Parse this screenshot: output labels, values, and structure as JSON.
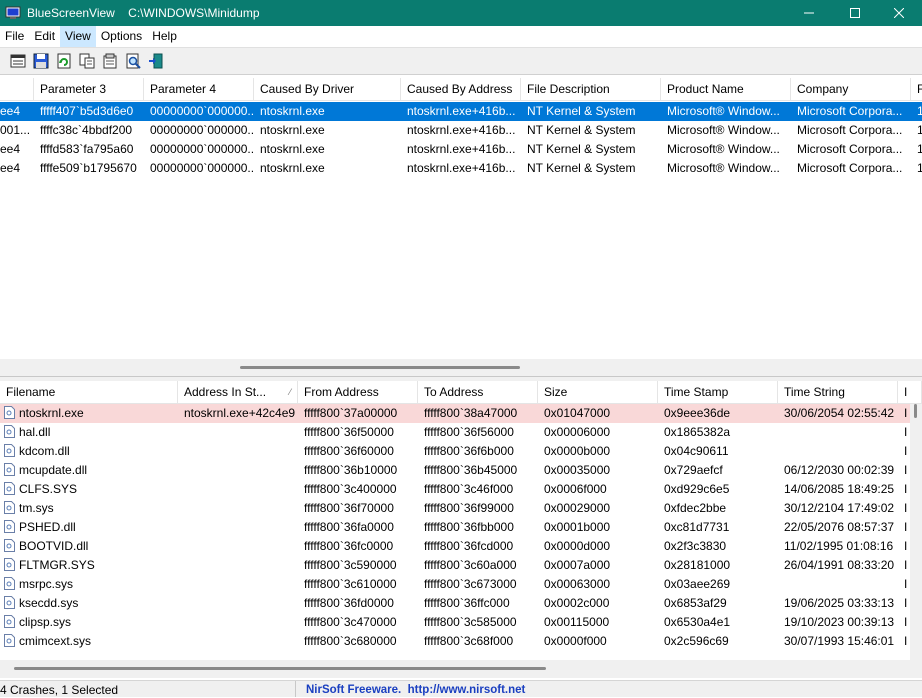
{
  "window": {
    "title": "BlueScreenView    C:\\WINDOWS\\Minidump",
    "minimize": "—",
    "maximize": "☐",
    "close": "✕"
  },
  "menu": [
    "File",
    "Edit",
    "View",
    "Options",
    "Help"
  ],
  "toolbar": {
    "icons": [
      "html-report-icon",
      "save-icon",
      "refresh-icon",
      "copy-icon",
      "properties-icon",
      "find-icon",
      "exit-icon"
    ]
  },
  "crash_list": {
    "columns": [
      "",
      "Parameter 3",
      "Parameter 4",
      "Caused By Driver",
      "Caused By Address",
      "File Description",
      "Product Name",
      "Company",
      "F"
    ],
    "rows": [
      [
        "ee4",
        "fffff407`b5d3d6e0",
        "00000000`000000...",
        "ntoskrnl.exe",
        "ntoskrnl.exe+416b...",
        "NT Kernel & System",
        "Microsoft® Window...",
        "Microsoft Corpora...",
        "1"
      ],
      [
        "001...",
        "ffffc38c`4bbdf200",
        "00000000`000000...",
        "ntoskrnl.exe",
        "ntoskrnl.exe+416b...",
        "NT Kernel & System",
        "Microsoft® Window...",
        "Microsoft Corpora...",
        "1"
      ],
      [
        "ee4",
        "ffffd583`fa795a60",
        "00000000`000000...",
        "ntoskrnl.exe",
        "ntoskrnl.exe+416b...",
        "NT Kernel & System",
        "Microsoft® Window...",
        "Microsoft Corpora...",
        "1"
      ],
      [
        "ee4",
        "ffffe509`b1795670",
        "00000000`000000...",
        "ntoskrnl.exe",
        "ntoskrnl.exe+416b...",
        "NT Kernel & System",
        "Microsoft® Window...",
        "Microsoft Corpora...",
        "1"
      ]
    ]
  },
  "driver_list": {
    "columns": [
      "Filename",
      "Address In St...",
      "From Address",
      "To Address",
      "Size",
      "Time Stamp",
      "Time String",
      "I"
    ],
    "rows": [
      [
        "ntoskrnl.exe",
        "ntoskrnl.exe+42c4e9",
        "fffff800`37a00000",
        "fffff800`38a47000",
        "0x01047000",
        "0x9eee36de",
        "30/06/2054 02:55:42",
        "I"
      ],
      [
        "hal.dll",
        "",
        "fffff800`36f50000",
        "fffff800`36f56000",
        "0x00006000",
        "0x1865382a",
        "",
        "I"
      ],
      [
        "kdcom.dll",
        "",
        "fffff800`36f60000",
        "fffff800`36f6b000",
        "0x0000b000",
        "0x04c90611",
        "",
        "I"
      ],
      [
        "mcupdate.dll",
        "",
        "fffff800`36b10000",
        "fffff800`36b45000",
        "0x00035000",
        "0x729aefcf",
        "06/12/2030 00:02:39",
        "I"
      ],
      [
        "CLFS.SYS",
        "",
        "fffff800`3c400000",
        "fffff800`3c46f000",
        "0x0006f000",
        "0xd929c6e5",
        "14/06/2085 18:49:25",
        "I"
      ],
      [
        "tm.sys",
        "",
        "fffff800`36f70000",
        "fffff800`36f99000",
        "0x00029000",
        "0xfdec2bbe",
        "30/12/2104 17:49:02",
        "I"
      ],
      [
        "PSHED.dll",
        "",
        "fffff800`36fa0000",
        "fffff800`36fbb000",
        "0x0001b000",
        "0xc81d7731",
        "22/05/2076 08:57:37",
        "I"
      ],
      [
        "BOOTVID.dll",
        "",
        "fffff800`36fc0000",
        "fffff800`36fcd000",
        "0x0000d000",
        "0x2f3c3830",
        "11/02/1995 01:08:16",
        "I"
      ],
      [
        "FLTMGR.SYS",
        "",
        "fffff800`3c590000",
        "fffff800`3c60a000",
        "0x0007a000",
        "0x28181000",
        "26/04/1991 08:33:20",
        "I"
      ],
      [
        "msrpc.sys",
        "",
        "fffff800`3c610000",
        "fffff800`3c673000",
        "0x00063000",
        "0x03aee269",
        "",
        "I"
      ],
      [
        "ksecdd.sys",
        "",
        "fffff800`36fd0000",
        "fffff800`36ffc000",
        "0x0002c000",
        "0x6853af29",
        "19/06/2025 03:33:13",
        "I"
      ],
      [
        "clipsp.sys",
        "",
        "fffff800`3c470000",
        "fffff800`3c585000",
        "0x00115000",
        "0x6530a4e1",
        "19/10/2023 00:39:13",
        "I"
      ],
      [
        "cmimcext.sys",
        "",
        "fffff800`3c680000",
        "fffff800`3c68f000",
        "0x0000f000",
        "0x2c596c69",
        "30/07/1993 15:46:01",
        "I"
      ]
    ]
  },
  "status": {
    "summary": "4 Crashes, 1 Selected",
    "credit": "NirSoft Freeware.  http://www.nirsoft.net"
  },
  "colors": {
    "titlebar": "#0a7c70",
    "selection": "#0078d7",
    "highlight_row": "#f9d8d8",
    "link": "#1a3fc0"
  }
}
